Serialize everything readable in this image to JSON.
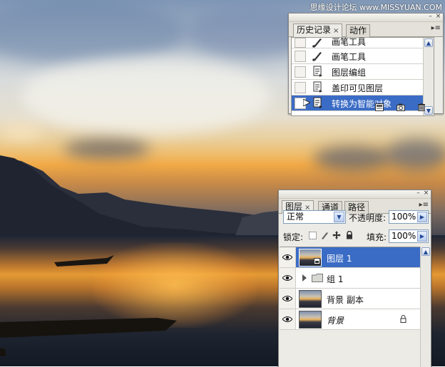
{
  "watermark": "思缘设计论坛 www.MISSYUAN.COM",
  "history_panel": {
    "tabs": [
      {
        "label": "历史记录",
        "active": true,
        "closable": true
      },
      {
        "label": "动作",
        "active": false
      }
    ],
    "items": [
      {
        "label": "画笔工具",
        "icon": "brush-icon"
      },
      {
        "label": "画笔工具",
        "icon": "brush-icon"
      },
      {
        "label": "图层编组",
        "icon": "history-state-icon"
      },
      {
        "label": "盖印可见图层",
        "icon": "history-state-icon"
      },
      {
        "label": "转换为智能对象",
        "icon": "history-state-icon",
        "selected": true
      }
    ],
    "footer_icons": [
      "new-document-from-state-icon",
      "snapshot-camera-icon",
      "trash-icon"
    ]
  },
  "layers_panel": {
    "tabs": [
      {
        "label": "图层",
        "active": true,
        "closable": true
      },
      {
        "label": "通道",
        "active": false
      },
      {
        "label": "路径",
        "active": false
      }
    ],
    "blend_mode": "正常",
    "opacity_label": "不透明度:",
    "opacity_value": "100%",
    "lock_label": "锁定:",
    "fill_label": "填充:",
    "fill_value": "100%",
    "layers": [
      {
        "name": "图层 1",
        "selected": true,
        "smart_object": true
      },
      {
        "name": "组 1",
        "type": "group"
      },
      {
        "name": "背景 副本"
      },
      {
        "name": "背景",
        "italic": true,
        "locked": true
      }
    ]
  },
  "colors": {
    "selection": "#3b6cc5",
    "panel_bg": "#ecebe6"
  }
}
